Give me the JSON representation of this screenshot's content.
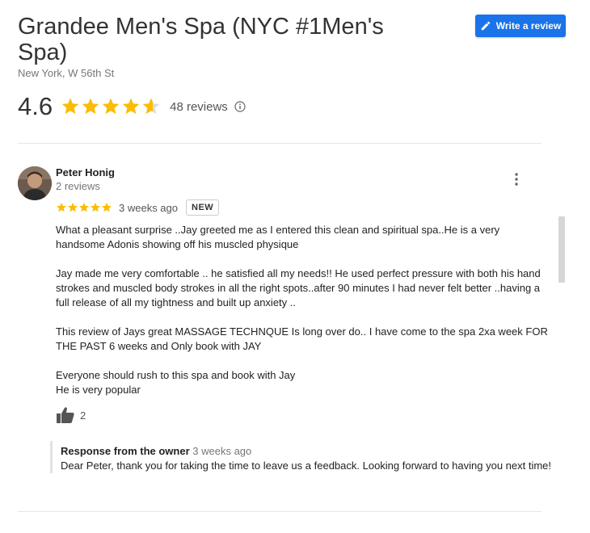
{
  "business": {
    "name": "Grandee Men's Spa (NYC #1Men's Spa)",
    "location": "New York, W 56th St",
    "rating": "4.6",
    "rating_value": 4.6,
    "reviews_label": "48 reviews"
  },
  "actions": {
    "write_review": "Write a review"
  },
  "colors": {
    "accent": "#1a73e8",
    "star": "#fbbc04",
    "star_empty": "#dadce0"
  },
  "review": {
    "author": "Peter Honig",
    "author_reviews": "2 reviews",
    "stars": 5,
    "time": "3 weeks ago",
    "badge": "NEW",
    "paragraphs": [
      "What a pleasant surprise ..Jay greeted me as I entered this clean and spiritual spa..He is a very handsome Adonis showing off his muscled physique",
      "Jay made me very comfortable .. he satisfied all my needs!! He used perfect pressure with both his hand strokes and muscled body strokes  in all the right spots..after 90 minutes I had never felt better ..having a full release of all my tightness and built up anxiety ..",
      "This review of Jays great MASSAGE TECHNQUE Is long over do.. I have come to the spa 2xa week FOR THE PAST 6 weeks and Only book with JAY",
      "Everyone should rush to this spa and book with Jay\nHe is very popular"
    ],
    "likes": "2",
    "owner_response": {
      "heading": "Response from the owner",
      "time": "3 weeks ago",
      "text": "Dear Peter, thank you for taking the time to leave us a feedback. Looking forward to having you next time!"
    }
  }
}
